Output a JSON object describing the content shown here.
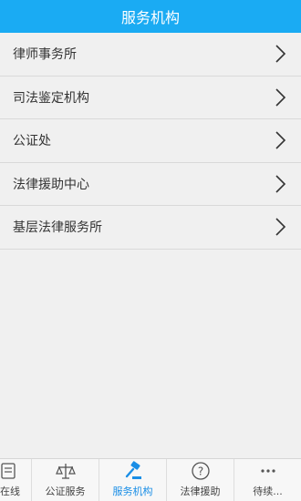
{
  "header": {
    "title": "服务机构"
  },
  "items": [
    {
      "label": "律师事务所"
    },
    {
      "label": "司法鉴定机构"
    },
    {
      "label": "公证处"
    },
    {
      "label": "法律援助中心"
    },
    {
      "label": "基层法律服务所"
    }
  ],
  "tabbar": {
    "tabs": [
      {
        "label": "在线",
        "icon": "document-icon"
      },
      {
        "label": "公证服务",
        "icon": "scales-icon"
      },
      {
        "label": "服务机构",
        "icon": "gavel-icon",
        "active": true
      },
      {
        "label": "法律援助",
        "icon": "help-icon"
      },
      {
        "label": "待续...",
        "icon": "more-icon"
      }
    ]
  },
  "colors": {
    "accent": "#1aabf3",
    "active_tab": "#1a8ee6",
    "background": "#f0f0f0"
  }
}
